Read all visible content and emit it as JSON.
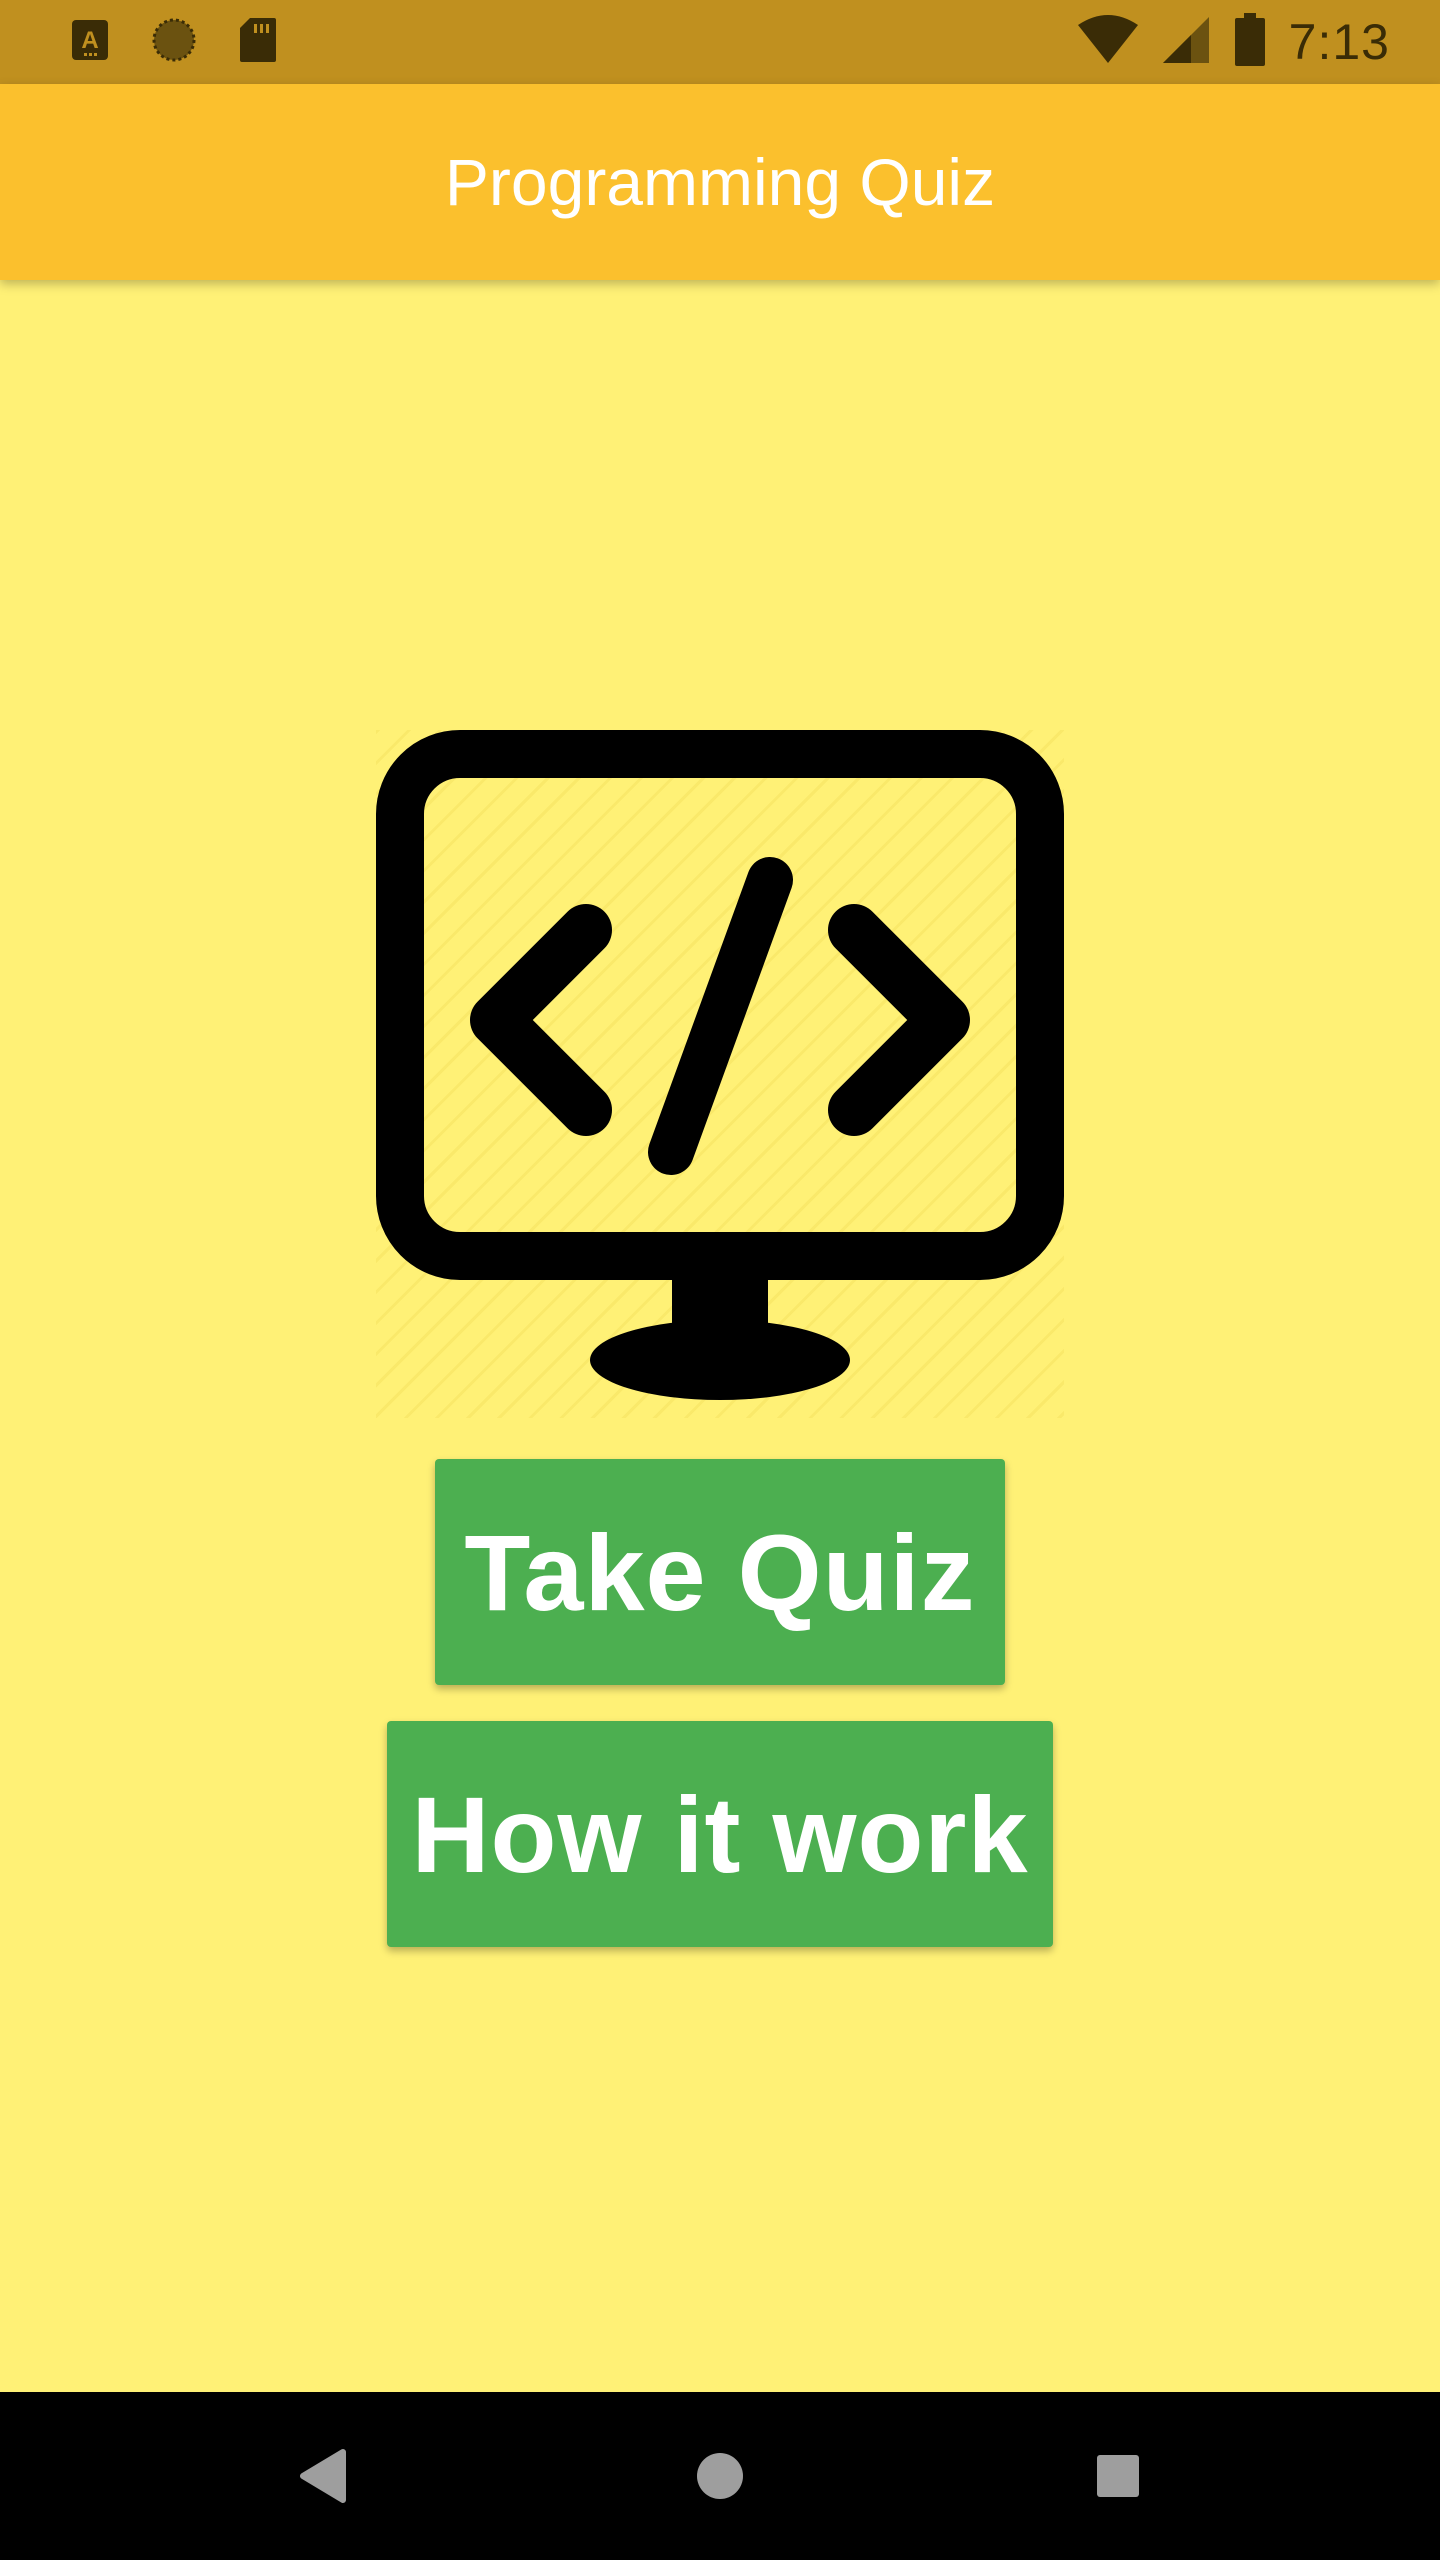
{
  "status_bar": {
    "time": "7:13",
    "left_icons": [
      "font-icon",
      "sync-icon",
      "sd-card-icon"
    ],
    "right_icons": [
      "wifi-icon",
      "cell-signal-icon",
      "battery-icon"
    ]
  },
  "app_bar": {
    "title": "Programming Quiz"
  },
  "hero": {
    "icon": "monitor-code-icon"
  },
  "buttons": {
    "take_quiz": "Take Quiz",
    "how_it_work": "How it work"
  },
  "nav_bar": {
    "icons": [
      "back-icon",
      "home-icon",
      "recents-icon"
    ]
  },
  "colors": {
    "status_bar": "#C0901F",
    "app_bar": "#FBC02D",
    "background": "#FFF176",
    "button": "#4CAF50",
    "nav_bar": "#000000"
  }
}
